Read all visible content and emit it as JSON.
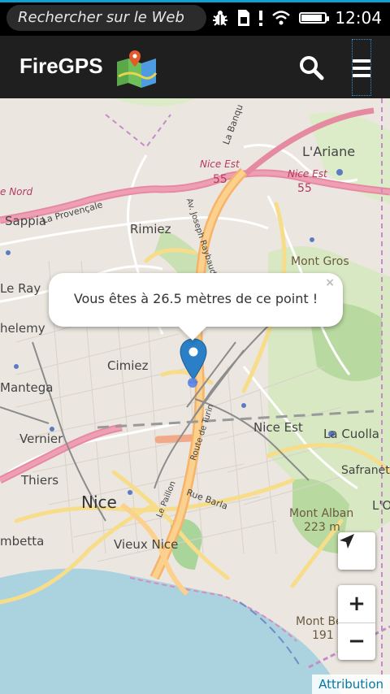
{
  "statusbar": {
    "search_placeholder": "Rechercher sur le Web",
    "time": "12:04",
    "battery_level_percent": 90,
    "icons": [
      "bug-icon",
      "sim-icon",
      "alert-icon",
      "wifi-icon",
      "battery-icon"
    ]
  },
  "appbar": {
    "title": "FireGPS",
    "logo_icon": "map-pin-logo-icon",
    "search_icon": "search-icon",
    "menu_icon": "hamburger-menu-icon"
  },
  "map": {
    "labels": {
      "ariane": "L'Ariane",
      "nice_est_1": "Nice Est",
      "nice_est_2": "Nice Est",
      "road55_1": "55",
      "road55_2": "55",
      "nice_nord": "e Nord",
      "sappia": "Sappia",
      "provencale": "La Provençale",
      "rimiez": "Rimiez",
      "mont_gros": "Mont Gros",
      "le_ray": "Le Ray",
      "chelemy": "helemy",
      "cimiez": "Cimiez",
      "mantega": "Mantega",
      "vernier": "Vernier",
      "thiers": "Thiers",
      "nice": "Nice",
      "nice_est_3": "Nice Est",
      "la_cuolla": "La Cuolla",
      "safranet": "Safranet",
      "mont_alban": "Mont Alban",
      "mont_alban_alt": "223 m",
      "locci": "L'Oc",
      "rue_barla": "Rue Barla",
      "vieux_nice": "Vieux Nice",
      "embetta": "mbetta",
      "mont_boron": "Mont Be",
      "mont_boron_alt": "191",
      "barla_street": "Av. Joseph Raybaud",
      "paillon": "Le Paillon",
      "turin": "Route de Turin",
      "la_banquiere": "La Banqu"
    },
    "popup": {
      "message": "Vous êtes à 26.5 mètres de ce point !",
      "close_label": "×"
    },
    "controls": {
      "locate_icon": "navigate-arrow-icon",
      "zoom_in": "+",
      "zoom_out": "−"
    },
    "attribution": "Attribution",
    "marker_icon": "location-marker-icon"
  },
  "colors": {
    "status_accent": "#0fa0d2",
    "appbar_bg": "#1f1f1f",
    "marker": "#2a7fc6",
    "attribution_link": "#0078a8"
  }
}
